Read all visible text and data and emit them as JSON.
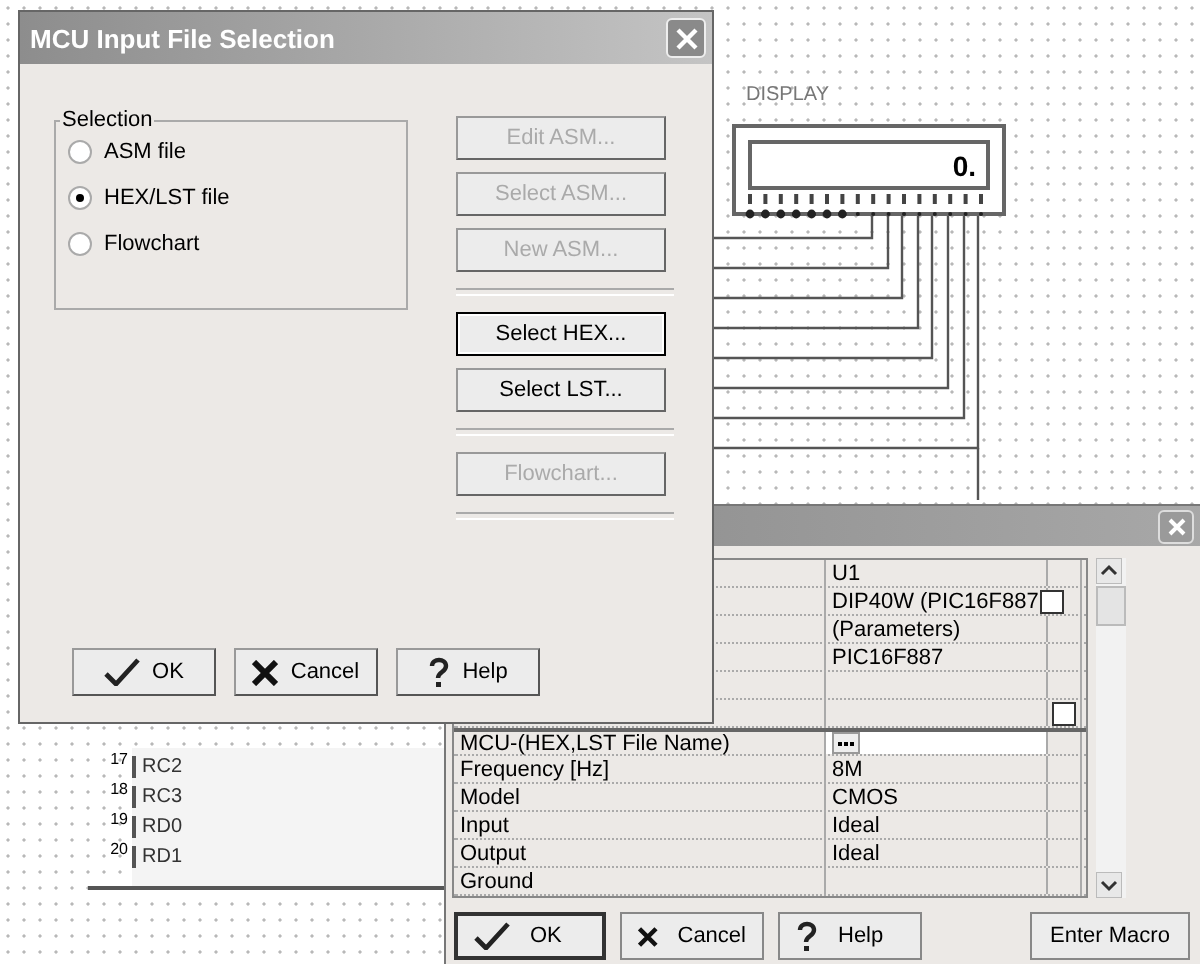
{
  "schematic": {
    "display": {
      "label": "DISPLAY",
      "value": "0."
    },
    "mcu_pins": [
      {
        "number": "17",
        "name": "RC2"
      },
      {
        "number": "18",
        "name": "RC3"
      },
      {
        "number": "19",
        "name": "RD0"
      },
      {
        "number": "20",
        "name": "RD1"
      }
    ]
  },
  "properties_dialog": {
    "rows": [
      {
        "kind": "text",
        "value": "U1"
      },
      {
        "kind": "checkbox",
        "value": "DIP40W (PIC16F887",
        "checked": false
      },
      {
        "kind": "text",
        "value": "(Parameters)"
      },
      {
        "kind": "text",
        "value": "PIC16F887"
      },
      {
        "kind": "blank"
      },
      {
        "kind": "side-checkbox",
        "checked": false
      },
      {
        "kind": "file",
        "name": "MCU-(HEX,LST File Name)"
      },
      {
        "kind": "text",
        "name": "Frequency [Hz]",
        "value": "8M"
      },
      {
        "kind": "text",
        "name": "Model",
        "value": "CMOS"
      },
      {
        "kind": "text",
        "name": "Input",
        "value": "Ideal"
      },
      {
        "kind": "text",
        "name": "Output",
        "value": "Ideal"
      },
      {
        "kind": "text",
        "name": "Ground"
      }
    ],
    "buttons": [
      {
        "kind": "ok",
        "label": "OK"
      },
      {
        "kind": "cancel",
        "label": "Cancel"
      },
      {
        "kind": "help",
        "label": "Help"
      },
      {
        "kind": "plain",
        "label": "Enter Macro"
      }
    ]
  },
  "window": {
    "title": "MCU Input File Selection",
    "group_label": "Selection",
    "radios": [
      {
        "label": "ASM file",
        "selected": false
      },
      {
        "label": "HEX/LST file",
        "selected": true
      },
      {
        "label": "Flowchart",
        "selected": false
      }
    ],
    "side_buttons": [
      {
        "kind": "button",
        "label": "Edit ASM...",
        "disabled": true
      },
      {
        "kind": "button",
        "label": "Select ASM...",
        "disabled": true
      },
      {
        "kind": "button",
        "label": "New ASM...",
        "disabled": true
      },
      {
        "kind": "divider"
      },
      {
        "kind": "button",
        "label": "Select HEX...",
        "disabled": false,
        "focused": true
      },
      {
        "kind": "button",
        "label": "Select LST...",
        "disabled": false
      },
      {
        "kind": "divider"
      },
      {
        "kind": "button",
        "label": "Flowchart...",
        "disabled": true
      },
      {
        "kind": "divider"
      }
    ],
    "buttons": [
      {
        "kind": "ok",
        "label": "OK"
      },
      {
        "kind": "cancel",
        "label": "Cancel"
      },
      {
        "kind": "help",
        "label": "Help"
      }
    ]
  }
}
